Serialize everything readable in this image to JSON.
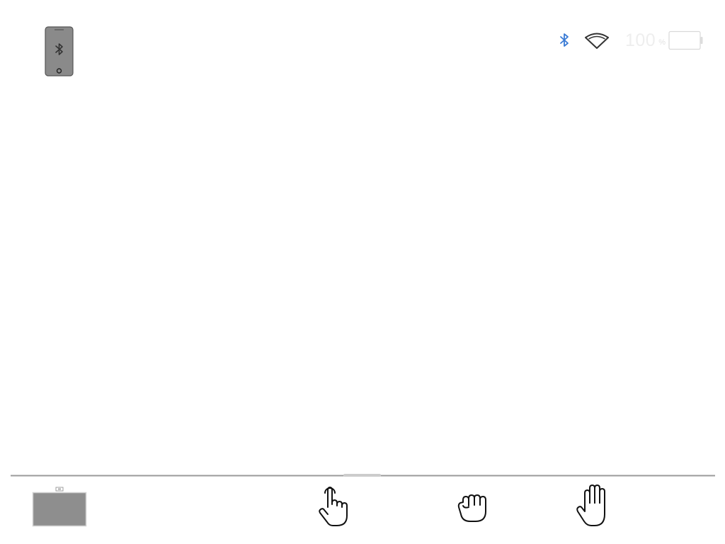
{
  "status_bar": {
    "bluetooth_icon": "bluetooth-icon",
    "wifi_icon": "wifi-icon",
    "battery_percent": "100",
    "battery_unit": "%",
    "battery_icon": "battery-icon",
    "accent_color": "#3a7bd5"
  },
  "device": {
    "icon": "bluetooth-phone-icon"
  },
  "tray": {
    "thumbnail_icon": "camera-preview-thumbnail",
    "gestures": [
      {
        "icon": "pointing-hand-icon"
      },
      {
        "icon": "fist-hand-icon"
      },
      {
        "icon": "open-palm-icon"
      }
    ]
  }
}
